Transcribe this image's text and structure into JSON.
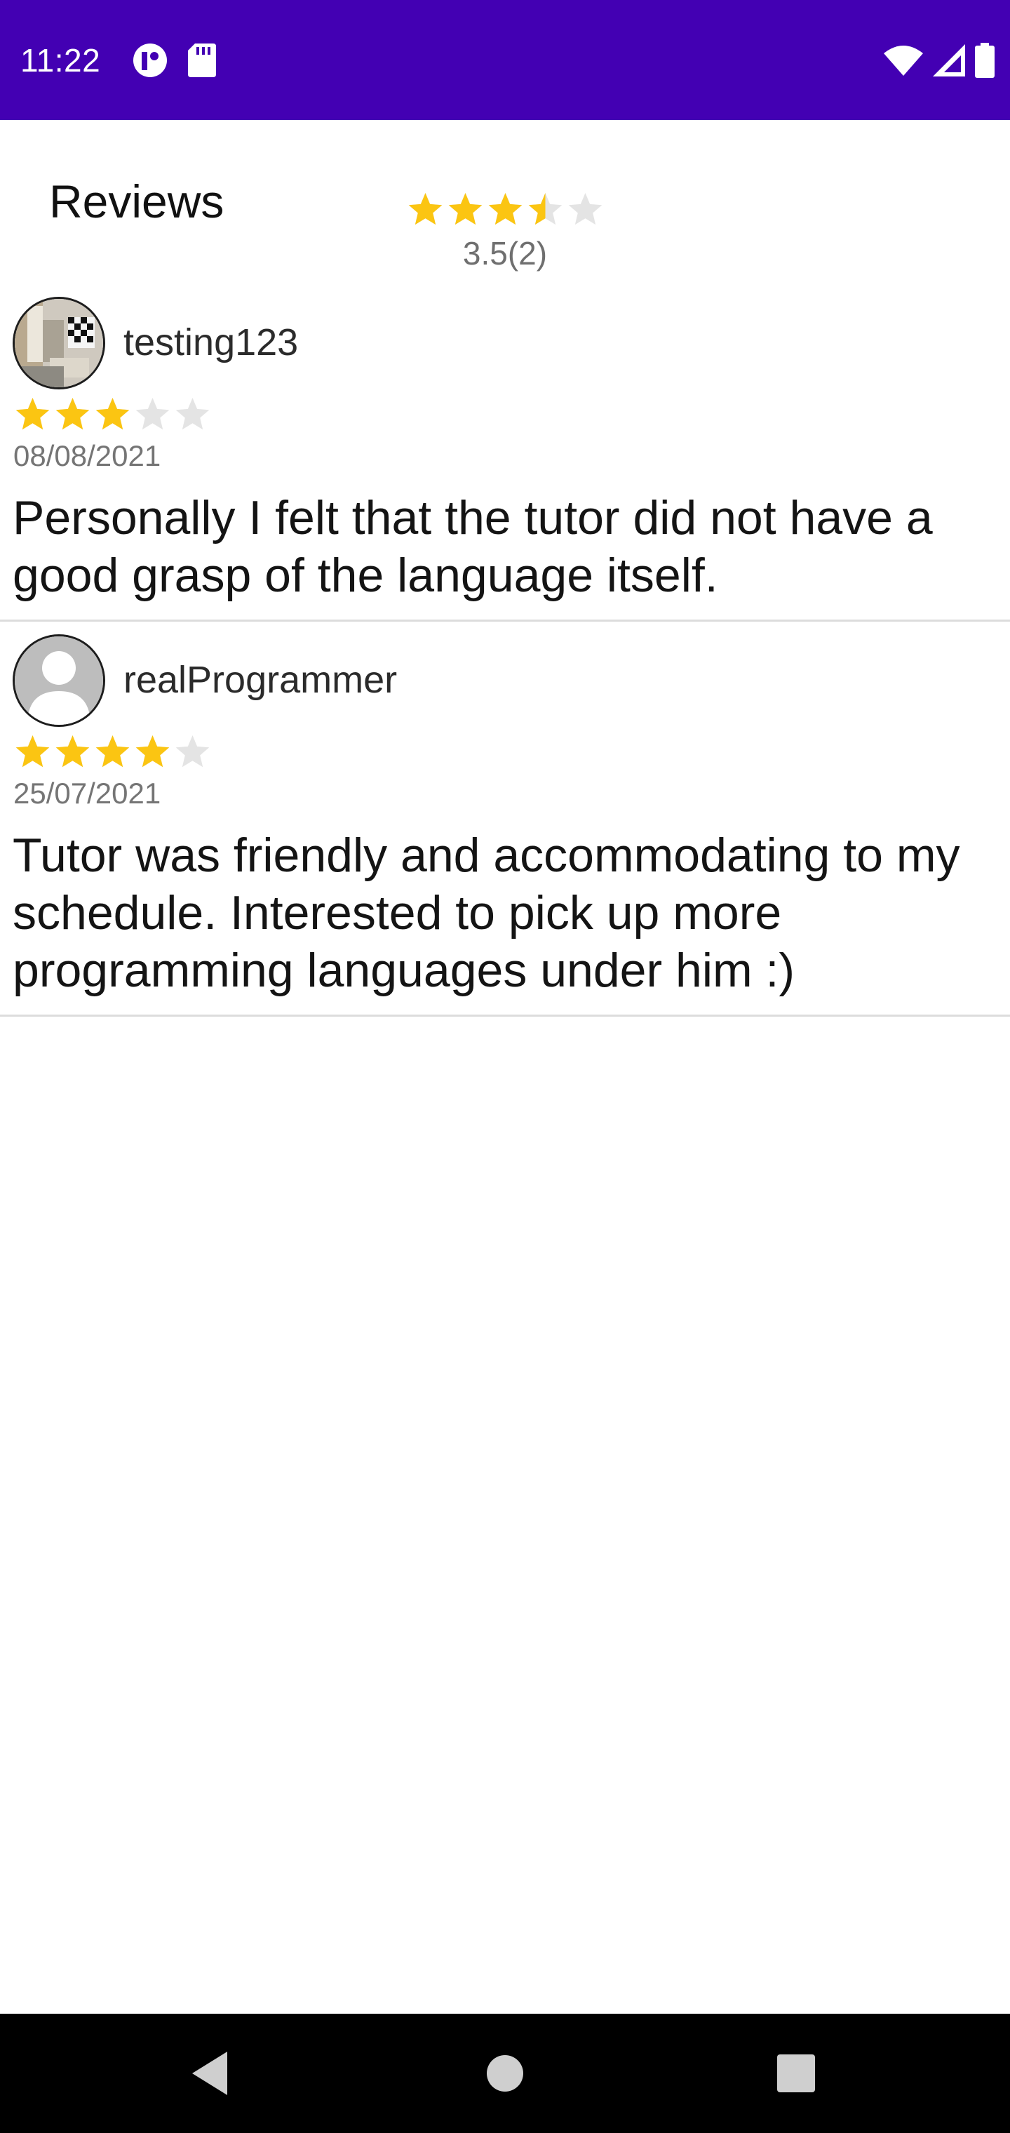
{
  "status_bar": {
    "time": "11:22",
    "background": "#4300b3",
    "left_icons": [
      "media-sync-icon",
      "sd-card-icon"
    ],
    "right_icons": [
      "wifi-icon",
      "cell-signal-icon",
      "battery-icon"
    ]
  },
  "header": {
    "title": "Reviews",
    "average_rating": 3.5,
    "max_rating": 5,
    "rating_summary": "3.5(2)"
  },
  "colors": {
    "star_filled": "#fbc512",
    "star_empty": "#e4e4e4"
  },
  "reviews": [
    {
      "username": "testing123",
      "avatar": "user-photo-avatar",
      "rating": 3,
      "date": "08/08/2021",
      "text": "Personally I felt that the tutor did not have a good grasp of the language itself."
    },
    {
      "username": "realProgrammer",
      "avatar": "default-person-avatar",
      "rating": 4,
      "date": "25/07/2021",
      "text": "Tutor was friendly and accommodating to my schedule. Interested to pick up more programming languages under him :)"
    }
  ],
  "nav_bar": {
    "buttons": [
      "back-icon",
      "home-icon",
      "recents-icon"
    ]
  }
}
